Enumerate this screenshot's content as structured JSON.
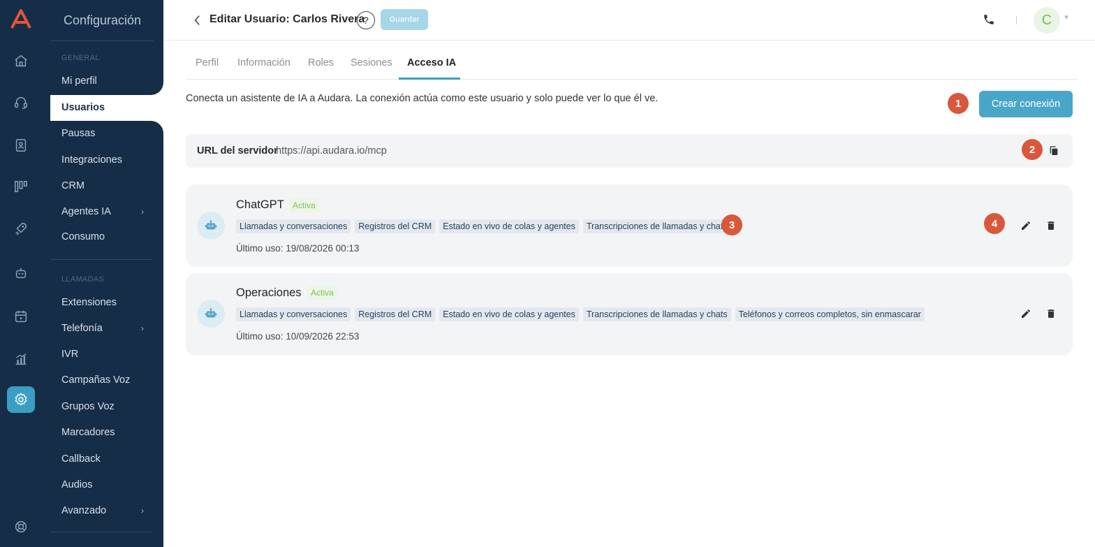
{
  "sidebar": {
    "title": "Configuración",
    "sections": {
      "general": "GENERAL",
      "calls": "LLAMADAS"
    },
    "items": {
      "mi_perfil": "Mi perfil",
      "usuarios": "Usuarios",
      "pausas": "Pausas",
      "integraciones": "Integraciones",
      "crm": "CRM",
      "agentes_ia": "Agentes IA",
      "consumo": "Consumo",
      "extensiones": "Extensiones",
      "telefonia": "Telefonía",
      "ivr": "IVR",
      "campanas_voz": "Campañas Voz",
      "grupos_voz": "Grupos Voz",
      "marcadores": "Marcadores",
      "callback": "Callback",
      "audios": "Audios",
      "avanzado": "Avanzado"
    }
  },
  "header": {
    "title": "Editar Usuario: Carlos Rivera",
    "help": "?",
    "save": "Guardar",
    "avatar_initial": "C"
  },
  "tabs": [
    "Perfil",
    "Información",
    "Roles",
    "Sesiones",
    "Acceso IA"
  ],
  "active_tab": "Acceso IA",
  "intro": "Conecta un asistente de IA a Audara. La conexión actúa como este usuario y solo puede ver lo que él ve.",
  "create_button": "Crear conexión",
  "badges": [
    "1",
    "2",
    "3",
    "4"
  ],
  "server": {
    "label": "URL del servidor",
    "url": "https://api.audara.io/mcp"
  },
  "connections": [
    {
      "name": "ChatGPT",
      "status": "Activa",
      "scopes": [
        "Llamadas y conversaciones",
        "Registros del CRM",
        "Estado en vivo de colas y agentes",
        "Transcripciones de llamadas y chats"
      ],
      "last_use": "Último uso: 19/08/2026 00:13"
    },
    {
      "name": "Operaciones",
      "status": "Activa",
      "scopes": [
        "Llamadas y conversaciones",
        "Registros del CRM",
        "Estado en vivo de colas y agentes",
        "Transcripciones de llamadas y chats",
        "Teléfonos y correos completos, sin enmascarar"
      ],
      "last_use": "Último uso: 10/09/2026 22:53"
    }
  ],
  "colors": {
    "sidebar_bg": "#152d47",
    "accent": "#4aa6c8",
    "badge": "#d9573b",
    "status_green": "#7cc05a"
  }
}
